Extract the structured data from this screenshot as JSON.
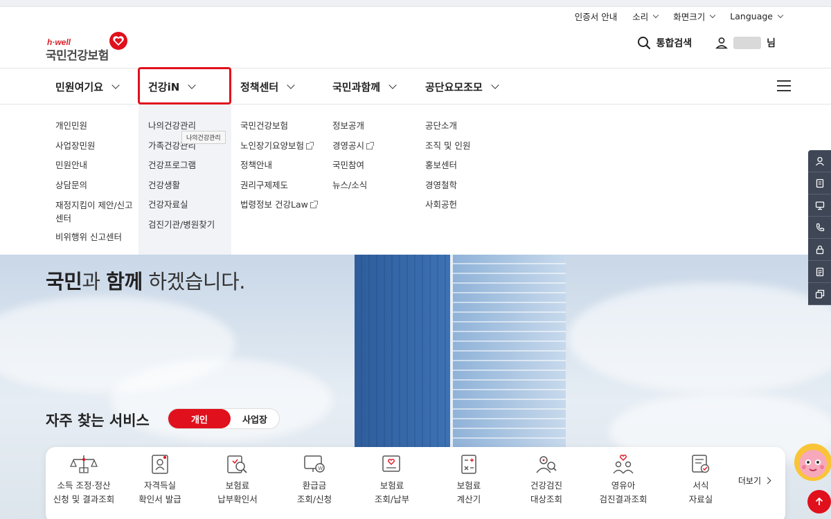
{
  "utility": {
    "cert": "인증서 안내",
    "sound": "소리",
    "screen": "화면크기",
    "language": "Language"
  },
  "logo": {
    "sub": "h·well",
    "main": "국민건강보험"
  },
  "header": {
    "search_label": "통합검색",
    "user_suffix": "님"
  },
  "gnb": {
    "items": [
      {
        "label": "민원여기요"
      },
      {
        "label": "건강iN"
      },
      {
        "label": "정책센터"
      },
      {
        "label": "국민과함께"
      },
      {
        "label": "공단요모조모"
      }
    ]
  },
  "mega": {
    "col1": [
      "개인민원",
      "사업장민원",
      "민원안내",
      "상담문의",
      "재정지킴이 제안/신고센터",
      "비위행위 신고센터"
    ],
    "col2": [
      "나의건강관리",
      "가족건강관리",
      "건강프로그램",
      "건강생활",
      "건강자료실",
      "검진기관/병원찾기"
    ],
    "col3": [
      "국민건강보험",
      "노인장기요양보험",
      "정책안내",
      "권리구제제도",
      "법령정보 건강Law"
    ],
    "col4": [
      "정보공개",
      "경영공시",
      "국민참여",
      "뉴스/소식"
    ],
    "col5": [
      "공단소개",
      "조직 및 인원",
      "홍보센터",
      "경영철학",
      "사회공헌"
    ],
    "tooltip": "나의건강관리"
  },
  "hero": {
    "line2_a": "국민",
    "line2_b": "과 ",
    "line2_c": "함께",
    "line2_d": " 하겠습니다."
  },
  "favorites": {
    "title": "자주 찾는 서비스",
    "tab_personal": "개인",
    "tab_business": "사업장",
    "more": "더보기",
    "services": [
      {
        "line1": "소득 조정·정산",
        "line2": "신청 및 결과조회"
      },
      {
        "line1": "자격득실",
        "line2": "확인서 발급"
      },
      {
        "line1": "보험료",
        "line2": "납부확인서"
      },
      {
        "line1": "환급금",
        "line2": "조회/신청"
      },
      {
        "line1": "보험료",
        "line2": "조회/납부"
      },
      {
        "line1": "보험료",
        "line2": "계산기"
      },
      {
        "line1": "건강검진",
        "line2": "대상조회"
      },
      {
        "line1": "영유아",
        "line2": "검진결과조회"
      },
      {
        "line1": "서식",
        "line2": "자료실"
      }
    ]
  },
  "colors": {
    "accent": "#e0101c",
    "quickbar": "#3f4756"
  }
}
